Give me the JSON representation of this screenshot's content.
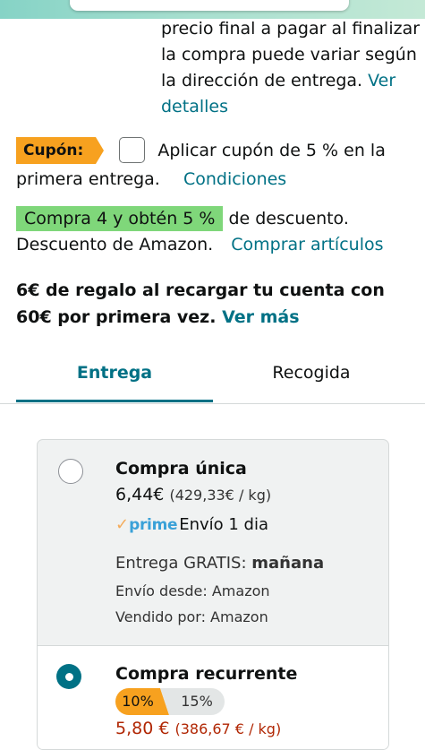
{
  "delivery_note": {
    "text": "precio final a pagar al finalizar la compra puede variar según la dirección de entrega.",
    "link": "Ver detalles"
  },
  "coupon": {
    "badge": "Cupón:",
    "text_line1": "Aplicar cupón de 5 % en la",
    "text_line2": "primera entrega.",
    "link": "Condiciones",
    "checked": false
  },
  "promo": {
    "badge": "Compra 4 y obtén 5 %",
    "text": "de descuento.",
    "line2": "Descuento de Amazon.",
    "link": "Comprar artículos"
  },
  "gift": {
    "text": "6€ de regalo al recargar tu cuenta con 60€ por primera vez.",
    "link": "Ver más"
  },
  "tabs": [
    {
      "label": "Entrega",
      "active": true
    },
    {
      "label": "Recogida",
      "active": false
    }
  ],
  "options": {
    "one_time": {
      "title": "Compra única",
      "price": "6,44€",
      "unit_price": "(429,33€ / kg)",
      "prime_label": "prime",
      "prime_shipping": "Envío 1 dia",
      "delivery_label": "Entrega GRATIS:",
      "delivery_day": "mañana",
      "ships_from": "Envío desde: Amazon",
      "sold_by": "Vendido por: Amazon",
      "selected": false
    },
    "recurring": {
      "title": "Compra recurrente",
      "discount_a": "10%",
      "discount_b": "15%",
      "price": "5,80 €",
      "unit_price": "(386,67 € / kg)",
      "selected": true
    }
  },
  "colors": {
    "link": "#007185",
    "coupon_badge": "#f7a11f",
    "promo_badge": "#7fd77a",
    "price_red": "#b12704",
    "prime_blue": "#3aa1d8"
  }
}
